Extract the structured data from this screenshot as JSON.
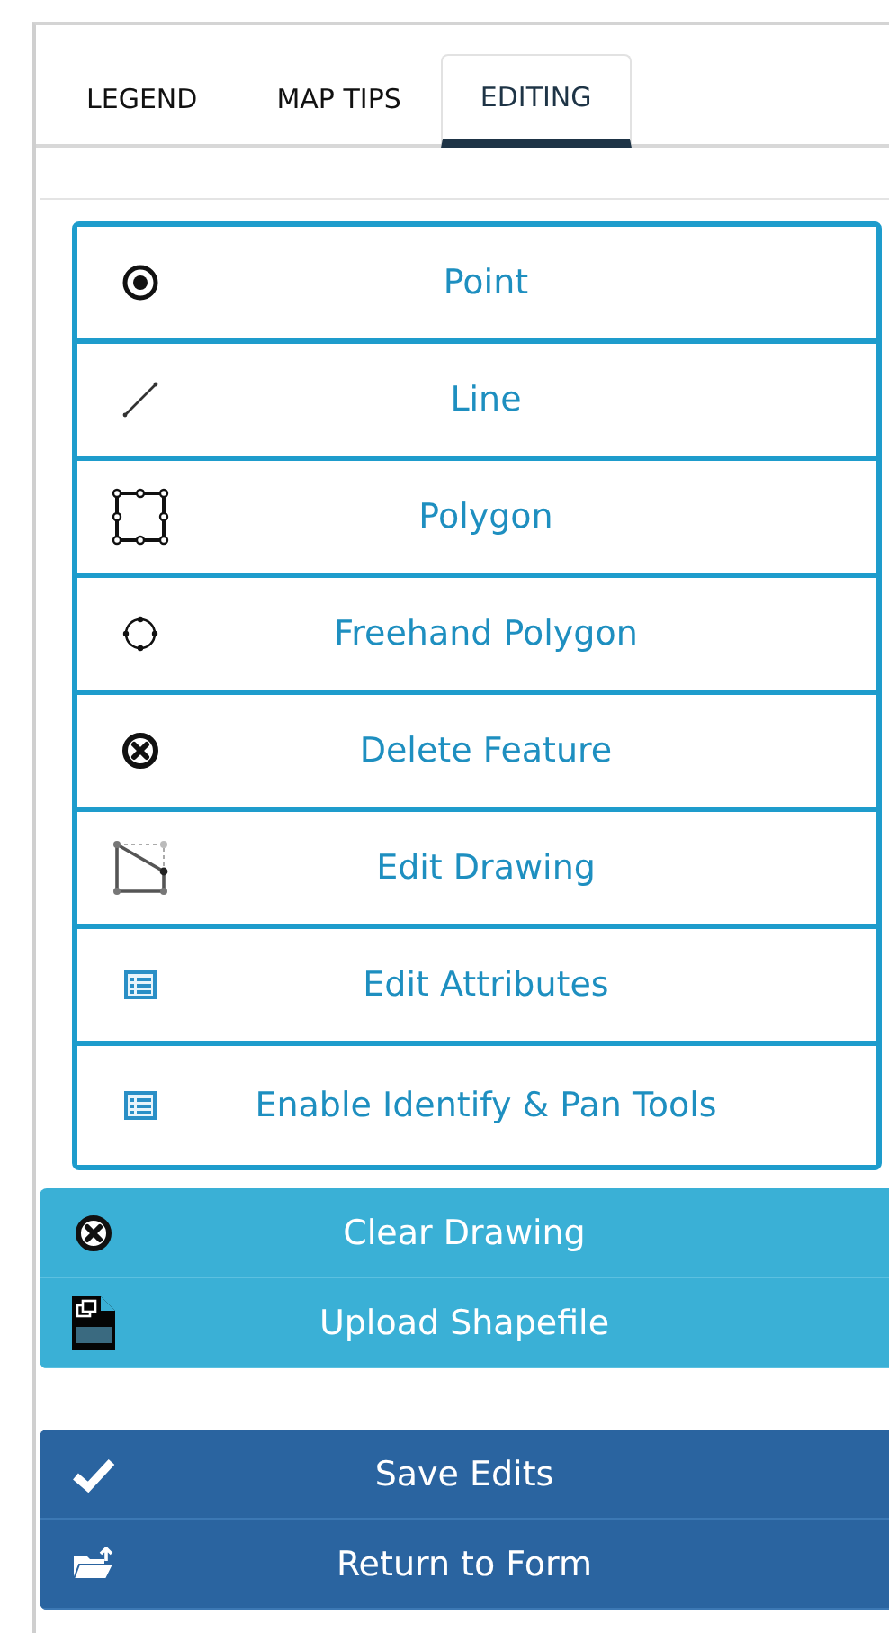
{
  "tabs": [
    {
      "label": "LEGEND",
      "selected": false
    },
    {
      "label": "MAP TIPS",
      "selected": false
    },
    {
      "label": "EDITING",
      "selected": true
    }
  ],
  "tools": [
    {
      "kind": "point",
      "label": "Point"
    },
    {
      "kind": "line",
      "label": "Line"
    },
    {
      "kind": "polygon",
      "label": "Polygon"
    },
    {
      "kind": "freehand",
      "label": "Freehand Polygon"
    },
    {
      "kind": "delete",
      "label": "Delete Feature"
    },
    {
      "kind": "edit",
      "label": "Edit Drawing"
    },
    {
      "kind": "table",
      "label": "Edit Attributes"
    },
    {
      "kind": "table",
      "label": "Enable Identify & Pan Tools"
    }
  ],
  "drawing_actions": [
    {
      "kind": "delete",
      "label": "Clear Drawing"
    },
    {
      "kind": "shapefile",
      "label": "Upload Shapefile"
    }
  ],
  "form_actions": [
    {
      "kind": "check",
      "label": "Save Edits"
    },
    {
      "kind": "folder",
      "label": "Return to Form"
    }
  ]
}
